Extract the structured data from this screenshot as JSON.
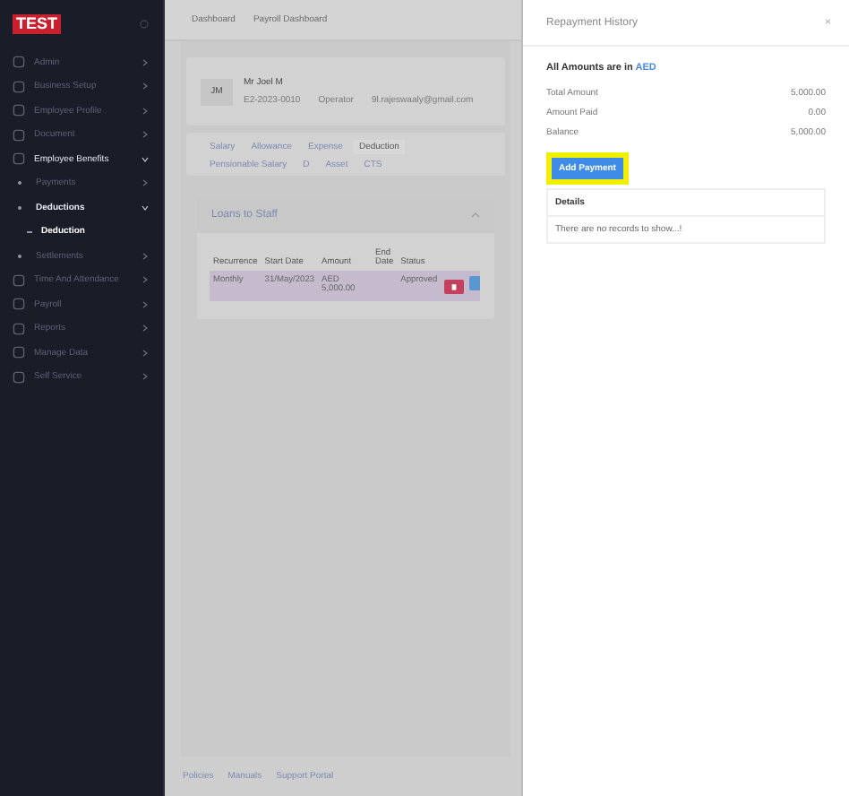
{
  "sidebar": {
    "logo": "TEST",
    "items": [
      {
        "label": "Admin",
        "kind": "group",
        "expanded": false,
        "selected": false
      },
      {
        "label": "Business Setup",
        "kind": "group",
        "expanded": false,
        "selected": false
      },
      {
        "label": "Employee Profile",
        "kind": "group",
        "expanded": false,
        "selected": false
      },
      {
        "label": "Document",
        "kind": "group",
        "expanded": false,
        "selected": false
      },
      {
        "label": "Employee Benefits",
        "kind": "group",
        "expanded": true,
        "selected": false
      },
      {
        "label": "Payments",
        "kind": "subgroup",
        "expanded": false,
        "selected": false
      },
      {
        "label": "Deductions",
        "kind": "subgroup",
        "expanded": true,
        "selected": false
      },
      {
        "label": "Deduction",
        "kind": "page",
        "expanded": false,
        "selected": true
      },
      {
        "label": "Settlements",
        "kind": "subgroup",
        "expanded": false,
        "selected": false
      },
      {
        "label": "Time And Attendance",
        "kind": "group",
        "expanded": false,
        "selected": false
      },
      {
        "label": "Payroll",
        "kind": "group",
        "expanded": false,
        "selected": false
      },
      {
        "label": "Reports",
        "kind": "group",
        "expanded": false,
        "selected": false
      },
      {
        "label": "Manage Data",
        "kind": "group",
        "expanded": false,
        "selected": false
      },
      {
        "label": "Self Service",
        "kind": "group",
        "expanded": false,
        "selected": false
      }
    ]
  },
  "breadcrumbs": [
    "Dashboard",
    "Payroll Dashboard"
  ],
  "employee": {
    "initials": "JM",
    "name": "Mr Joel M",
    "code": "E2-2023-0010",
    "role": "Operator",
    "email": "9l.rajeswaaly@gmail.com"
  },
  "tabs": [
    {
      "label": "Salary",
      "selected": false
    },
    {
      "label": "Allowance",
      "selected": false
    },
    {
      "label": "Expense",
      "selected": false
    },
    {
      "label": "Deduction",
      "selected": true
    },
    {
      "label": "Pensionable Salary",
      "selected": false
    },
    {
      "label": "D",
      "selected": false
    },
    {
      "label": "Asset",
      "selected": false
    },
    {
      "label": "CTS",
      "selected": false
    }
  ],
  "loans": {
    "title": "Loans to Staff",
    "columns": [
      "Recurrence",
      "Start Date",
      "Amount",
      "End Date",
      "Status"
    ],
    "rows": [
      {
        "cells": [
          "Monthly",
          "31/May/2023",
          "AED 5,000.00",
          "",
          "Approved"
        ],
        "selected": true
      }
    ]
  },
  "footer_links": [
    "Policies",
    "Manuals",
    "Support Portal"
  ],
  "drawer": {
    "title": "Repayment History",
    "close": "×",
    "currency_label": "All Amounts are in",
    "currency": "AED",
    "summary": [
      {
        "label": "Total Amount",
        "value": "5,000.00"
      },
      {
        "label": "Amount Paid",
        "value": "0.00"
      },
      {
        "label": "Balance",
        "value": "5,000.00"
      }
    ],
    "button": "Add Payment",
    "details_heading": "Details",
    "empty_text": "There are no records to show...!"
  }
}
